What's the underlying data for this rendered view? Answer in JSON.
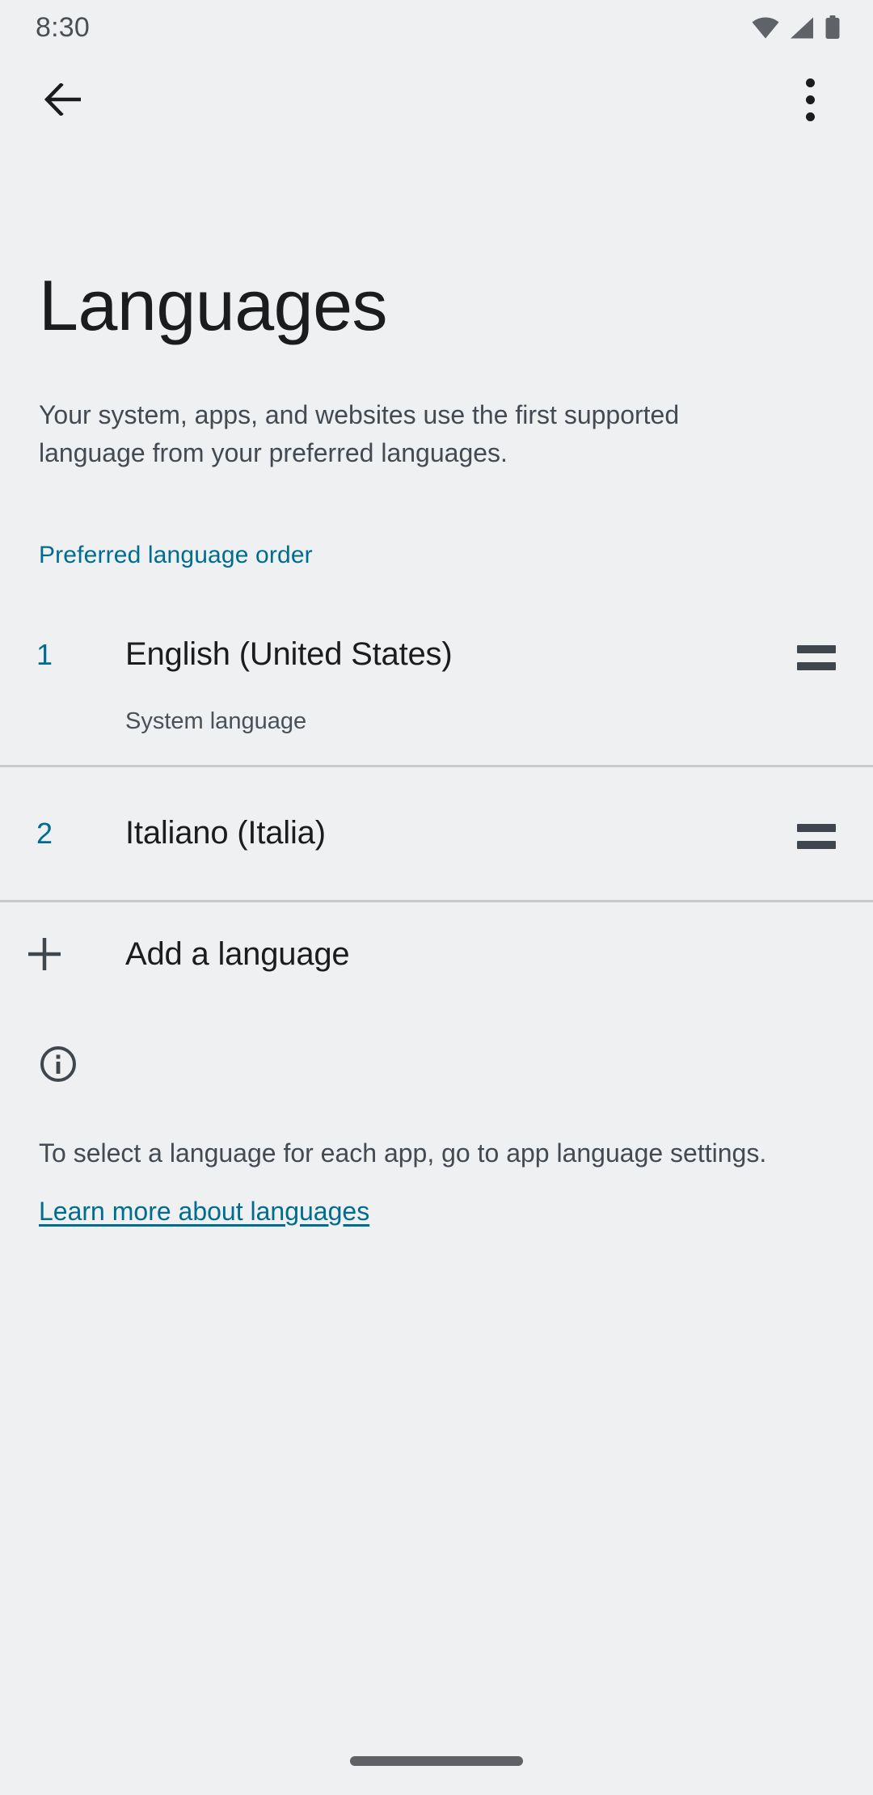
{
  "theme": {
    "background": "#eff0f2",
    "accent": "#006d8f",
    "text_primary": "#1b1c1e",
    "text_secondary": "#434a51",
    "divider": "#c9cacd"
  },
  "status_bar": {
    "time": "8:30",
    "icons": [
      "wifi-icon",
      "cellular-signal-icon",
      "battery-icon"
    ]
  },
  "action_bar": {
    "back_icon": "back-arrow-icon",
    "overflow_icon": "more-options-icon"
  },
  "header": {
    "title": "Languages",
    "description": "Your system, apps, and websites use the first supported language from your preferred languages."
  },
  "section": {
    "header": "Preferred language order"
  },
  "languages": [
    {
      "order": "1",
      "name": "English (United States)",
      "subtitle": "System language",
      "drag_icon": "drag-handle-icon"
    },
    {
      "order": "2",
      "name": "Italiano (Italia)",
      "subtitle": "",
      "drag_icon": "drag-handle-icon"
    }
  ],
  "add_language": {
    "icon": "plus-icon",
    "label": "Add a language"
  },
  "footer": {
    "icon": "info-circle-icon",
    "text": "To select a language for each app, go to app language settings.",
    "link": "Learn more about languages"
  },
  "navigation_bar": {
    "type": "gesture-pill"
  }
}
